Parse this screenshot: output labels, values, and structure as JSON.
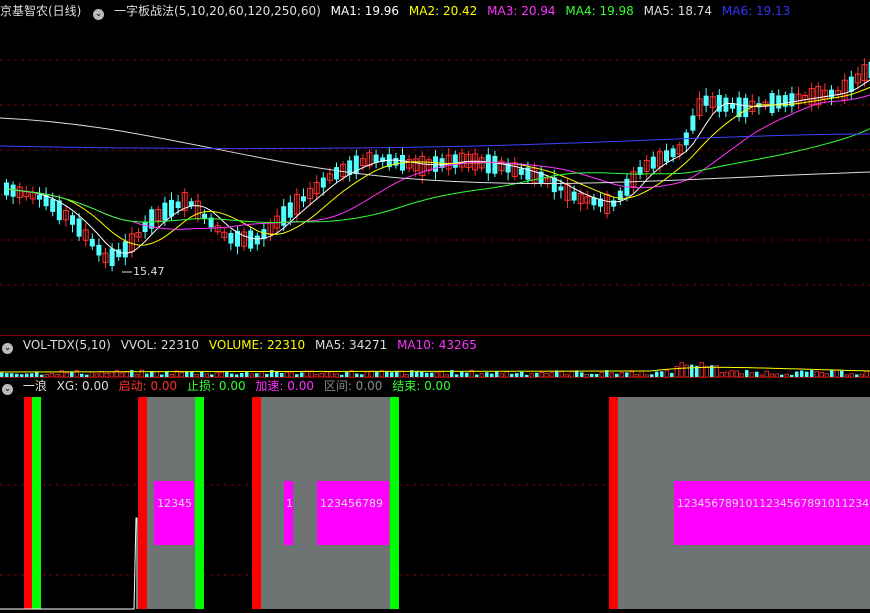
{
  "main_header": {
    "stock_name": "京基智农(日线)",
    "indicator": "一字板战法(5,10,20,60,120,250,60)",
    "items": [
      {
        "label": "MA1: 19.96",
        "color": "#ffffff"
      },
      {
        "label": "MA2: 20.42",
        "color": "#ffff00"
      },
      {
        "label": "MA3: 20.94",
        "color": "#ff33ff"
      },
      {
        "label": "MA4: 19.98",
        "color": "#33ff33"
      },
      {
        "label": "MA5: 18.74",
        "color": "#dddddd"
      },
      {
        "label": "MA6: 19.13",
        "color": "#3333ff"
      }
    ]
  },
  "price_annotation": "15.47",
  "vol_header": {
    "indicator": "VOL-TDX(5,10)",
    "items": [
      {
        "label": "VVOL: 22310",
        "color": "#dddddd"
      },
      {
        "label": "VOLUME: 22310",
        "color": "#ffff00"
      },
      {
        "label": "MA5: 34271",
        "color": "#dddddd"
      },
      {
        "label": "MA10: 43265",
        "color": "#ff33ff"
      }
    ]
  },
  "wave_header": {
    "indicator": "一浪",
    "items": [
      {
        "label": "XG: 0.00",
        "color": "#dddddd"
      },
      {
        "label": "启动: 0.00",
        "color": "#ff3030"
      },
      {
        "label": "止损: 0.00",
        "color": "#33ff33"
      },
      {
        "label": "加速: 0.00",
        "color": "#ff33ff"
      },
      {
        "label": "区间: 0.00",
        "color": "#888888"
      },
      {
        "label": "结束: 0.00",
        "color": "#33ff33"
      }
    ]
  },
  "wave_labels": [
    "12345",
    "1",
    "123456789",
    "1234567891011234567891011234"
  ],
  "colors": {
    "up": "#ff3030",
    "down": "#54ffff",
    "grid": "#7a0000",
    "bg": "#000000",
    "zone": "#6e7373",
    "start": "#ff0000",
    "end": "#00ff00",
    "accel": "#ff00ff"
  }
}
